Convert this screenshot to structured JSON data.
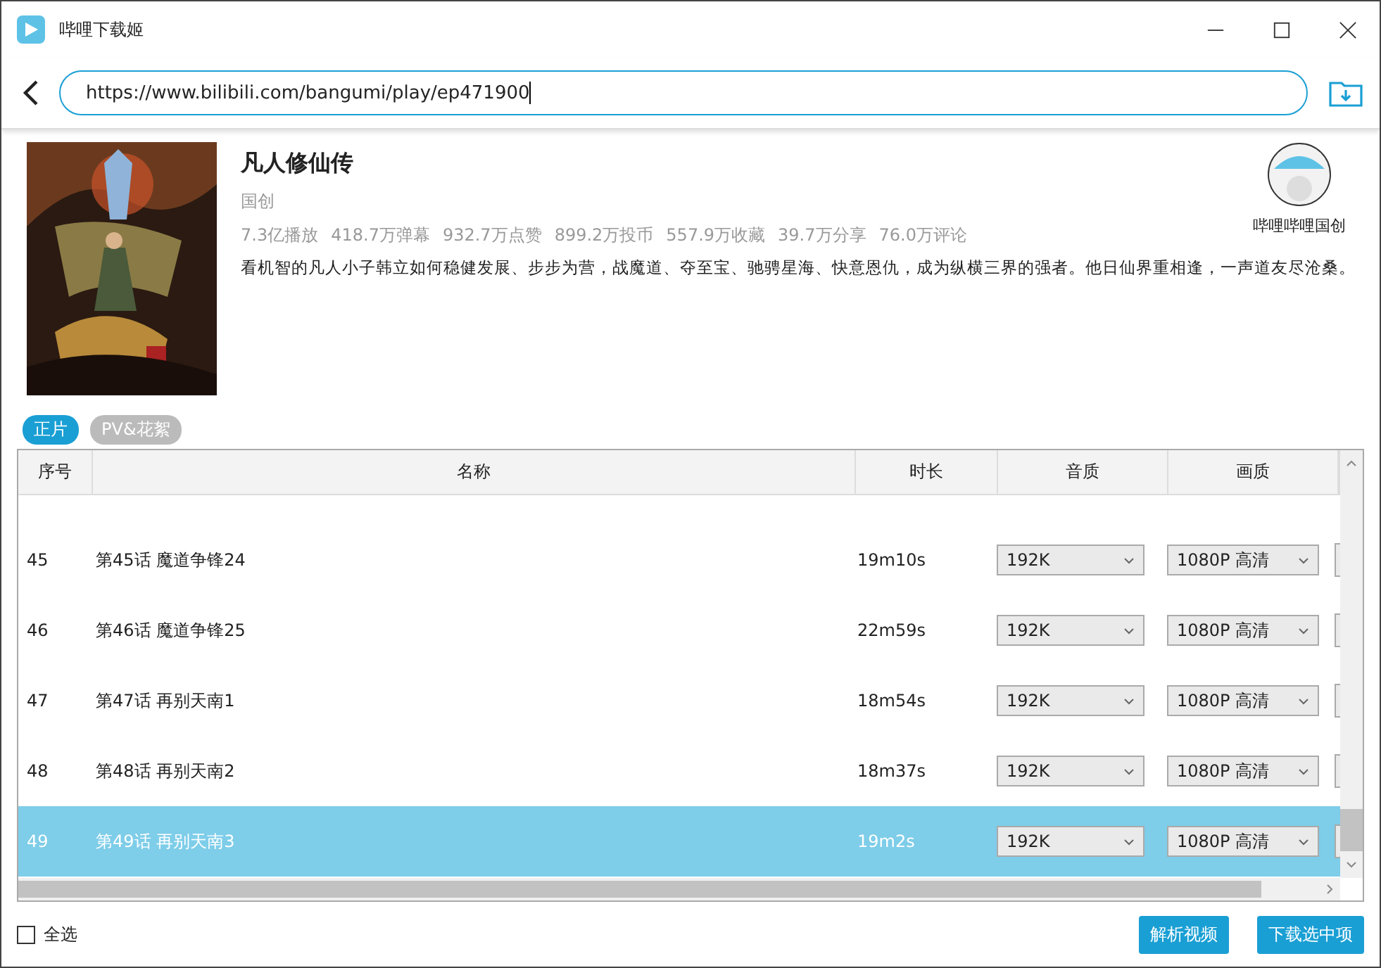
{
  "window": {
    "title": "哔哩下载姬"
  },
  "address": {
    "value": "https://www.bilibili.com/bangumi/play/ep471900"
  },
  "info": {
    "title": "凡人修仙传",
    "category": "国创",
    "stats": [
      "7.3亿播放",
      "418.7万弹幕",
      "932.7万点赞",
      "899.2万投币",
      "557.9万收藏",
      "39.7万分享",
      "76.0万评论"
    ],
    "description": "看机智的凡人小子韩立如何稳健发展、步步为营，战魔道、夺至宝、驰骋星海、快意恩仇，成为纵横三界的强者。他日仙界重相逢，一声道友尽沧桑。",
    "uploader": "哔哩哔哩国创"
  },
  "tabs": [
    {
      "label": "正片",
      "selected": true
    },
    {
      "label": "PV&花絮",
      "selected": false
    }
  ],
  "table": {
    "columns": [
      "序号",
      "名称",
      "时长",
      "音质",
      "画质"
    ],
    "rows": [
      {
        "index": "45",
        "name": "第45话 魔道争锋24",
        "duration": "19m10s",
        "audio": "192K",
        "video": "1080P 高清",
        "selected": false
      },
      {
        "index": "46",
        "name": "第46话 魔道争锋25",
        "duration": "22m59s",
        "audio": "192K",
        "video": "1080P 高清",
        "selected": false
      },
      {
        "index": "47",
        "name": "第47话 再别天南1",
        "duration": "18m54s",
        "audio": "192K",
        "video": "1080P 高清",
        "selected": false
      },
      {
        "index": "48",
        "name": "第48话 再别天南2",
        "duration": "18m37s",
        "audio": "192K",
        "video": "1080P 高清",
        "selected": false
      },
      {
        "index": "49",
        "name": "第49话 再别天南3",
        "duration": "19m2s",
        "audio": "192K",
        "video": "1080P 高清",
        "selected": true
      }
    ]
  },
  "select_all": {
    "label": "全选",
    "checked": false
  },
  "buttons": [
    "解析视频",
    "下载选中项"
  ]
}
